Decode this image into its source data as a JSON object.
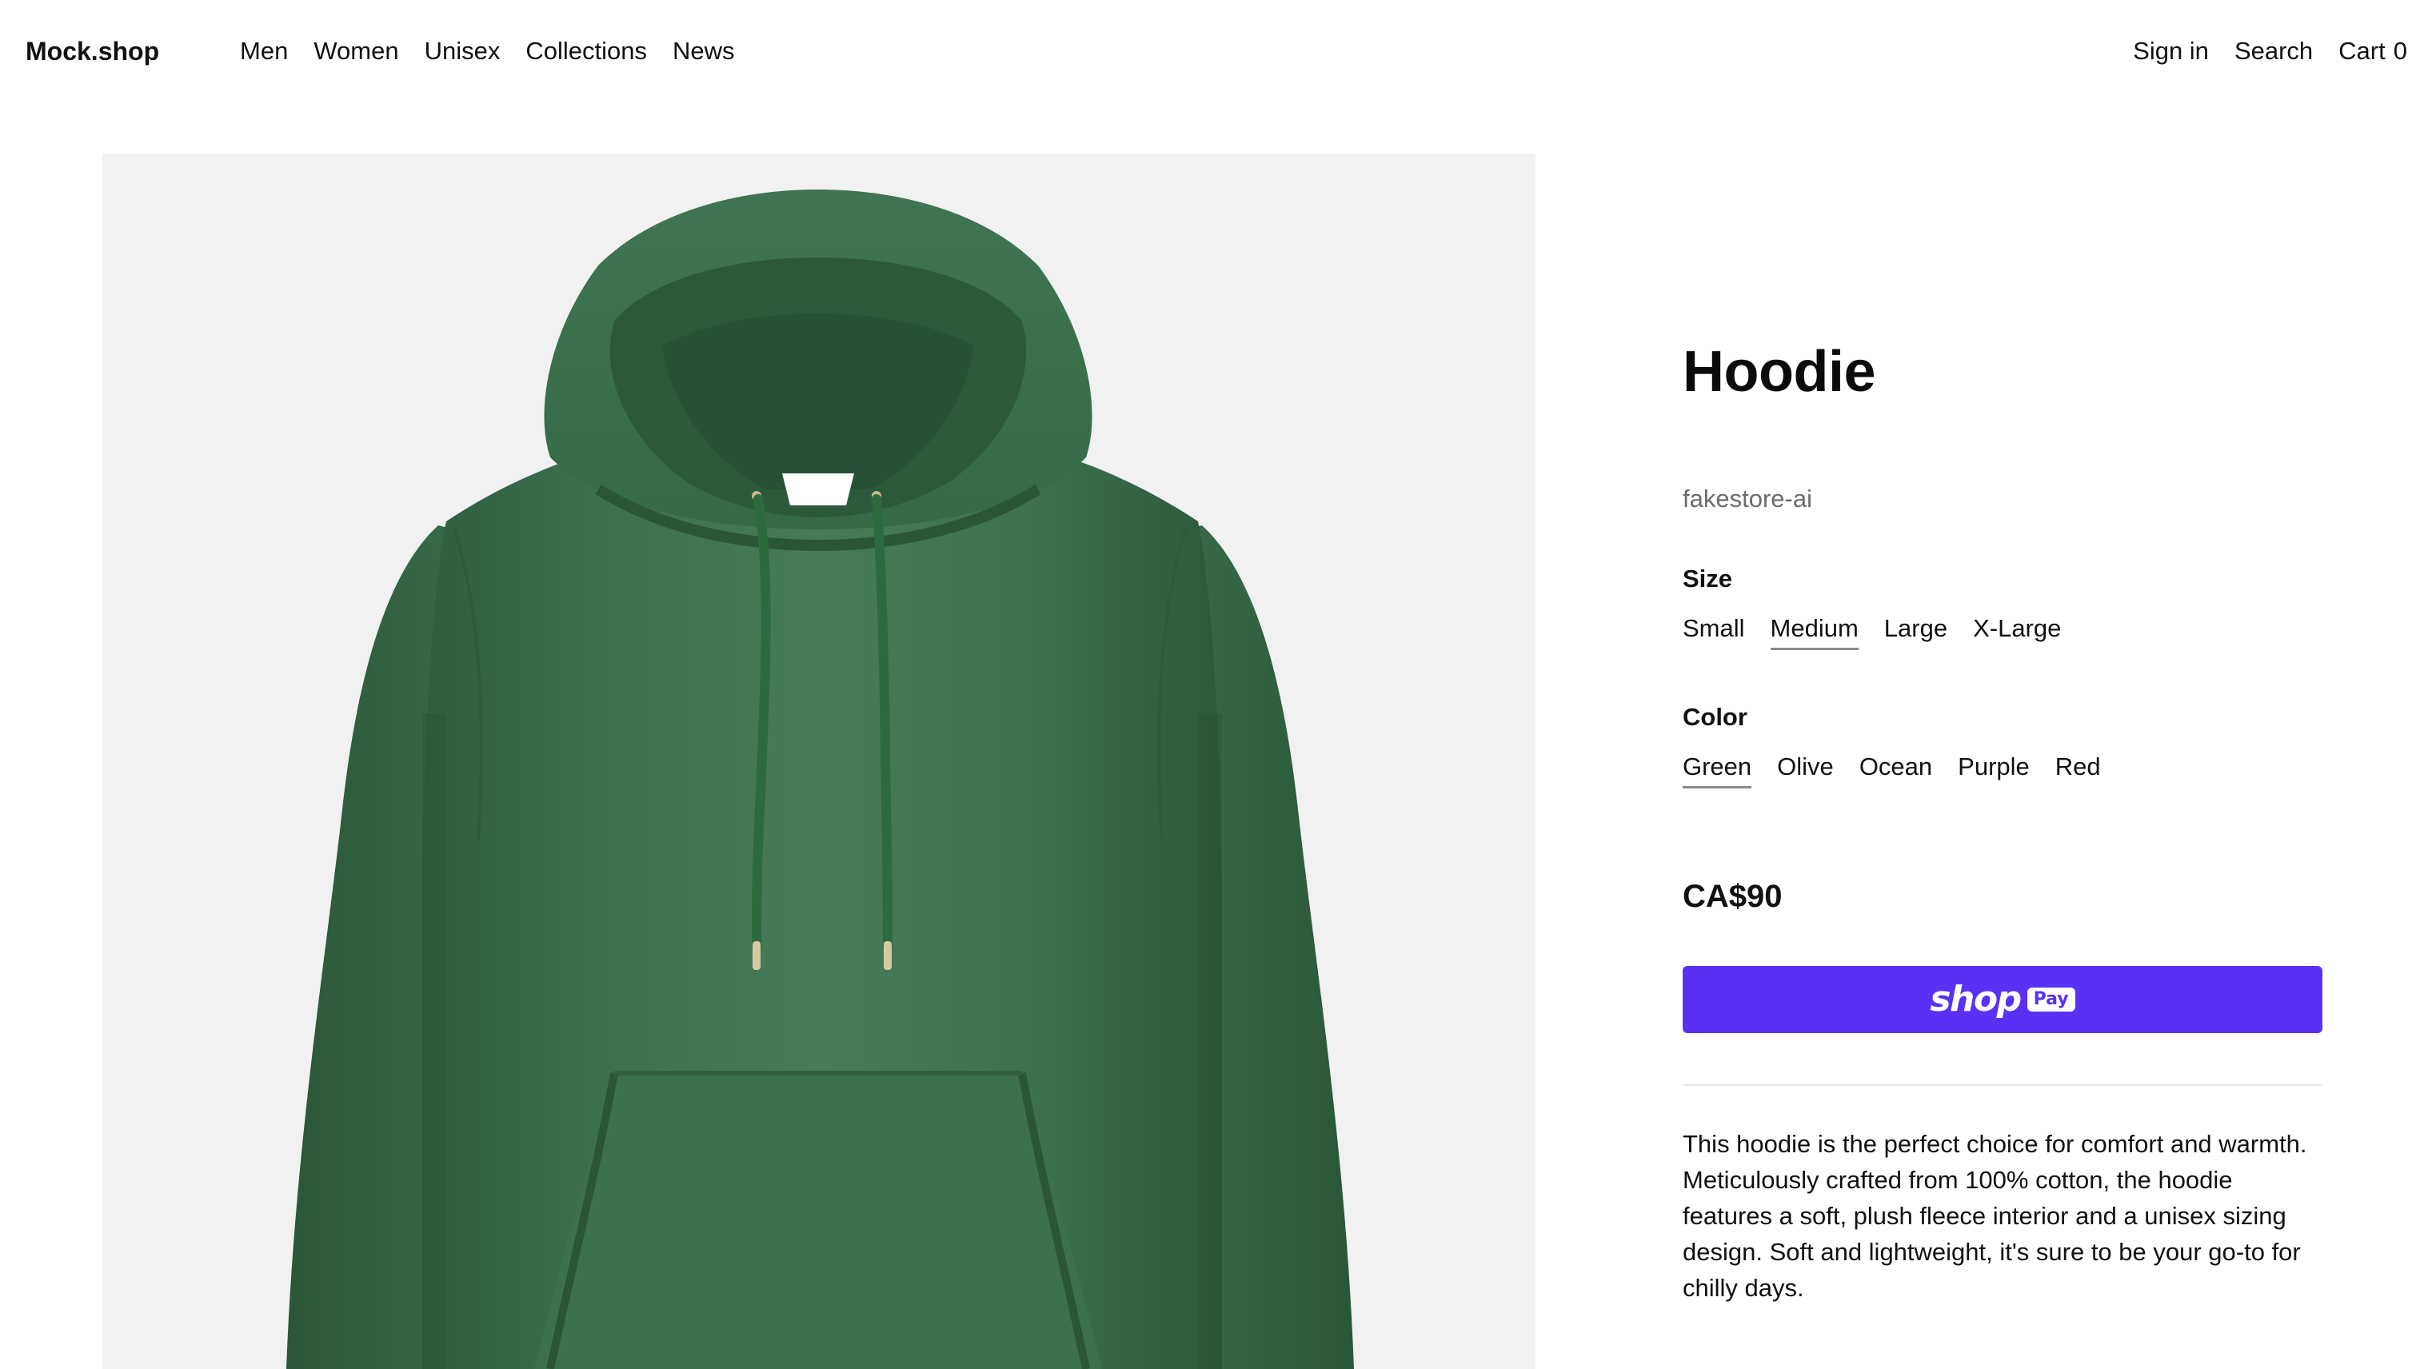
{
  "header": {
    "brand": "Mock.shop",
    "nav": [
      {
        "label": "Men"
      },
      {
        "label": "Women"
      },
      {
        "label": "Unisex"
      },
      {
        "label": "Collections"
      },
      {
        "label": "News"
      }
    ],
    "sign_in": "Sign in",
    "search": "Search",
    "cart_label": "Cart",
    "cart_count": "0"
  },
  "product": {
    "title": "Hoodie",
    "vendor": "fakestore-ai",
    "size": {
      "label": "Size",
      "options": [
        "Small",
        "Medium",
        "Large",
        "X-Large"
      ],
      "selected": "Medium"
    },
    "color": {
      "label": "Color",
      "options": [
        "Green",
        "Olive",
        "Ocean",
        "Purple",
        "Red"
      ],
      "selected": "Green"
    },
    "price": "CA$90",
    "buy_button": {
      "brand_text": "shop",
      "badge_text": "Pay",
      "color": "#5a31f4"
    },
    "description": "This hoodie is the perfect choice for comfort and warmth. Meticulously crafted from 100% cotton, the hoodie features a soft, plush fleece interior and a unisex sizing design. Soft and lightweight, it's sure to be your go-to for chilly days.",
    "image": {
      "subject": "green hoodie",
      "background_color": "#f1f1f1",
      "garment_color": "#3e7450"
    }
  }
}
